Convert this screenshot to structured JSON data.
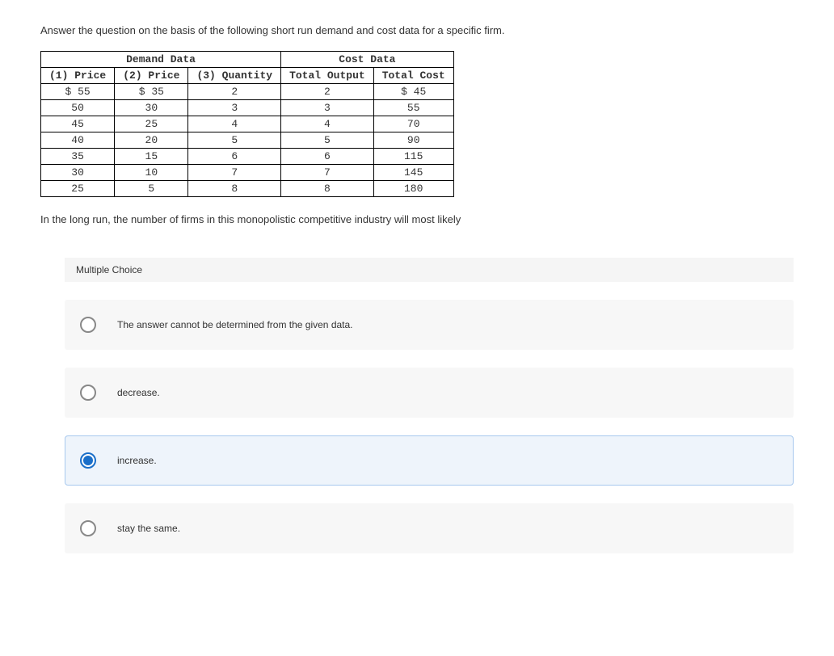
{
  "question_intro": "Answer the question on the basis of the following short run demand and cost data for a specific firm.",
  "table": {
    "header_demand": "Demand Data",
    "header_cost": "Cost Data",
    "cols": {
      "c1": "(1) Price",
      "c2": "(2) Price",
      "c3": "(3) Quantity",
      "c4": "Total Output",
      "c5": "Total Cost"
    },
    "rows": [
      {
        "c1": "$ 55",
        "c2": "$ 35",
        "c3": "2",
        "c4": "2",
        "c5": "$ 45"
      },
      {
        "c1": "50",
        "c2": "30",
        "c3": "3",
        "c4": "3",
        "c5": "55"
      },
      {
        "c1": "45",
        "c2": "25",
        "c3": "4",
        "c4": "4",
        "c5": "70"
      },
      {
        "c1": "40",
        "c2": "20",
        "c3": "5",
        "c4": "5",
        "c5": "90"
      },
      {
        "c1": "35",
        "c2": "15",
        "c3": "6",
        "c4": "6",
        "c5": "115"
      },
      {
        "c1": "30",
        "c2": "10",
        "c3": "7",
        "c4": "7",
        "c5": "145"
      },
      {
        "c1": "25",
        "c2": "5",
        "c3": "8",
        "c4": "8",
        "c5": "180"
      }
    ]
  },
  "sub_question": "In the long run, the number of firms in this monopolistic competitive industry will most likely",
  "mc_label": "Multiple Choice",
  "choices": [
    {
      "text": "The answer cannot be determined from the given data.",
      "selected": false
    },
    {
      "text": "decrease.",
      "selected": false
    },
    {
      "text": "increase.",
      "selected": true
    },
    {
      "text": "stay the same.",
      "selected": false
    }
  ]
}
